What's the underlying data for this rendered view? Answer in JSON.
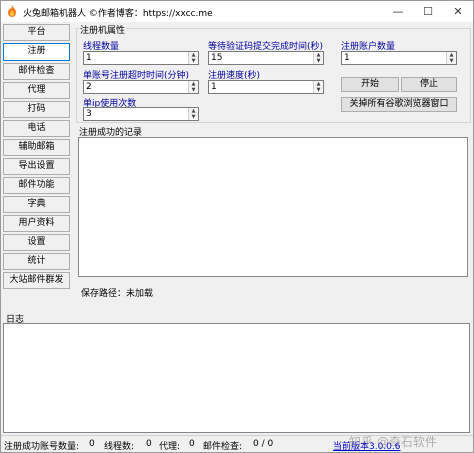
{
  "title_bar": {
    "title": "火兔邮箱机器人 ©作者博客：https://xxcc.me",
    "minimize_glyph": "—",
    "maximize_glyph": "☐",
    "close_glyph": "✕",
    "app_icon": "fire-rabbit-icon"
  },
  "sidebar": {
    "items": [
      {
        "label": "平台"
      },
      {
        "label": "注册"
      },
      {
        "label": "邮件检查"
      },
      {
        "label": "代理"
      },
      {
        "label": "打码"
      },
      {
        "label": "电话"
      },
      {
        "label": "辅助邮箱"
      },
      {
        "label": "导出设置"
      },
      {
        "label": "邮件功能"
      },
      {
        "label": "字典"
      },
      {
        "label": "用户资料"
      },
      {
        "label": "设置"
      },
      {
        "label": "统计"
      },
      {
        "label": "大站邮件群发"
      }
    ]
  },
  "register": {
    "group_title": "注册机属性",
    "threads_label": "线程数量",
    "threads_value": "1",
    "wait_label": "等待验证码提交完成时间(秒)",
    "wait_value": "15",
    "accounts_label": "注册账户数量",
    "accounts_value": "1",
    "timeout_label": "单账号注册超时时间(分钟)",
    "timeout_value": "2",
    "speed_label": "注册速度(秒)",
    "speed_value": "1",
    "ip_label": "单ip使用次数",
    "ip_value": "3",
    "start_button": "开始",
    "stop_button": "停止",
    "close_browsers_button": "关掉所有谷歌浏览器窗口",
    "spin_up": "▲",
    "spin_down": "▼"
  },
  "success_records": {
    "label": "注册成功的记录"
  },
  "save_path": {
    "text": "保存路径：未加载"
  },
  "log": {
    "label": "日志"
  },
  "status_bar": {
    "success_label": "注册成功账号数量:",
    "success_value": "0",
    "threads_label": "线程数:",
    "threads_value": "0",
    "proxy_label": "代理:",
    "proxy_value": "0",
    "mail_check_label": "邮件检查:",
    "mail_check_value": "0 / 0",
    "version_link": "当前版本3.0.0.6",
    "watermark": "知乎 @奇石软件"
  }
}
